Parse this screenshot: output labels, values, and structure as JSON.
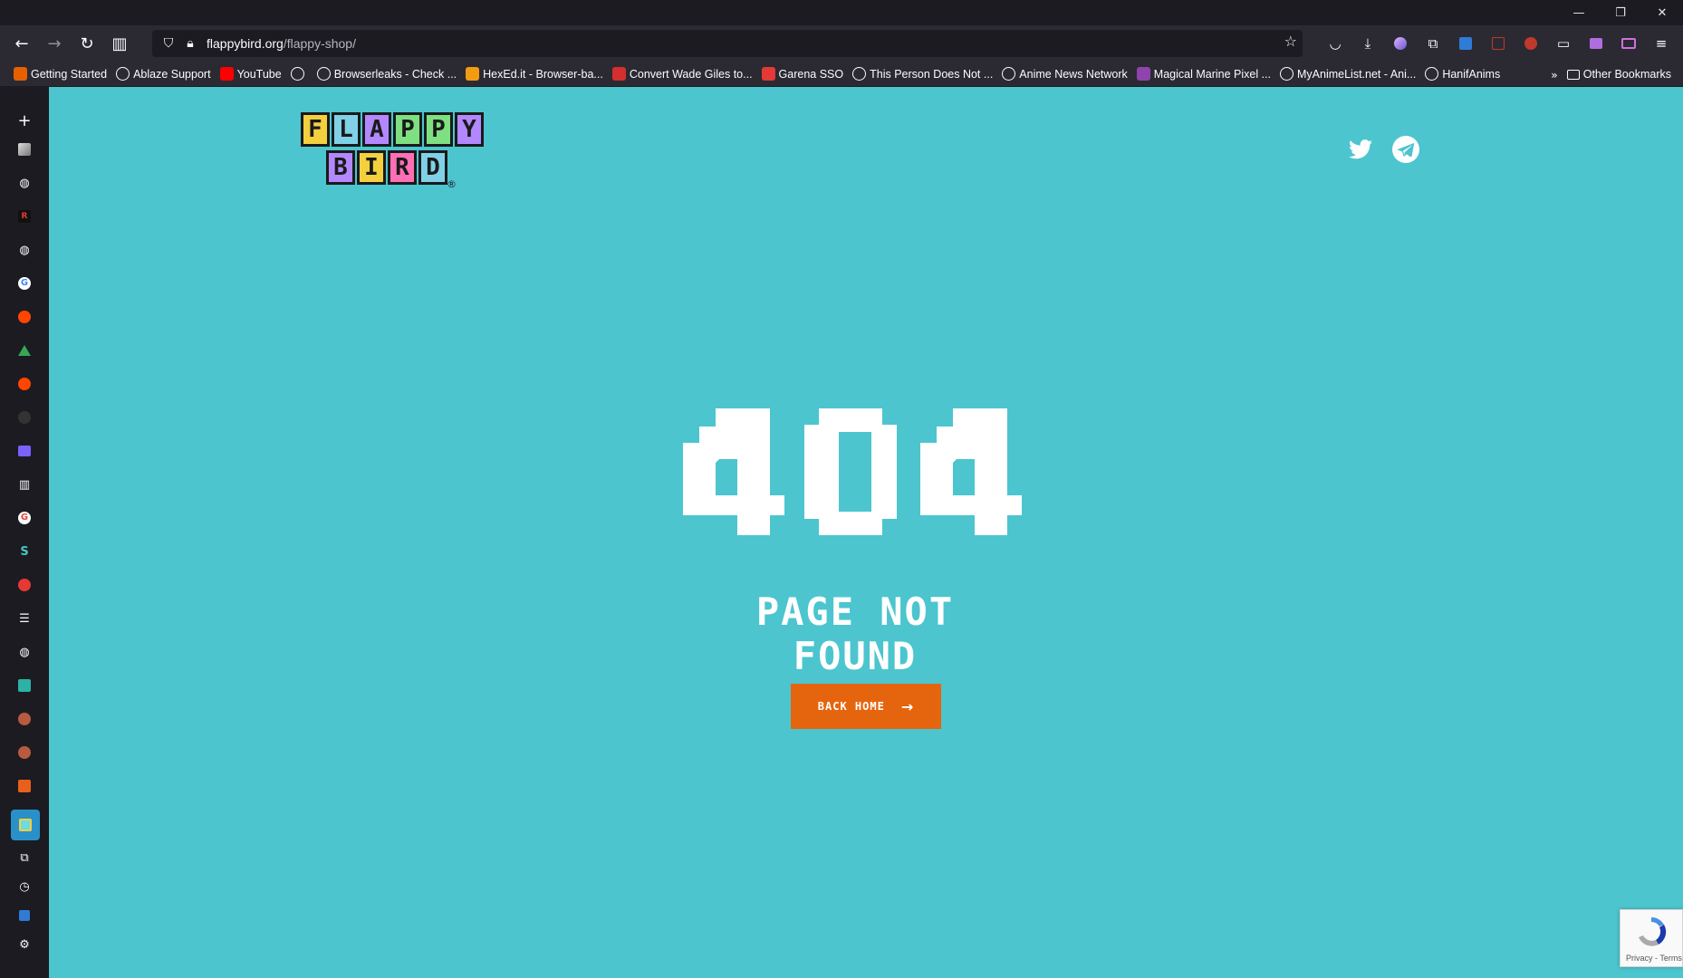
{
  "window": {
    "minimize": "—",
    "restore": "❐",
    "close": "✕"
  },
  "nav": {
    "url_domain": "flappybird.org",
    "url_path": "/flappy-shop/"
  },
  "bookmarks": [
    {
      "label": "Getting Started",
      "icon": "firefox-icon",
      "color": "#e66000"
    },
    {
      "label": "Ablaze Support",
      "icon": "globe-icon",
      "color": ""
    },
    {
      "label": "YouTube",
      "icon": "youtube-icon",
      "color": "#ff0000"
    },
    {
      "label": "",
      "icon": "globe-icon",
      "color": ""
    },
    {
      "label": "Browserleaks - Check ...",
      "icon": "globe-icon",
      "color": ""
    },
    {
      "label": "HexEd.it - Browser-ba...",
      "icon": "hexed-icon",
      "color": "#f39c12"
    },
    {
      "label": "Convert Wade Giles to...",
      "icon": "convert-icon",
      "color": "#d32f2f"
    },
    {
      "label": "Garena SSO",
      "icon": "garena-icon",
      "color": "#e53935"
    },
    {
      "label": "This Person Does Not ...",
      "icon": "globe-icon",
      "color": ""
    },
    {
      "label": "Anime News Network",
      "icon": "globe-icon",
      "color": ""
    },
    {
      "label": "Magical Marine Pixel ...",
      "icon": "pixel-icon",
      "color": "#8e44ad"
    },
    {
      "label": "MyAnimeList.net - Ani...",
      "icon": "globe-icon",
      "color": ""
    },
    {
      "label": "HanifAnims",
      "icon": "globe-icon",
      "color": ""
    }
  ],
  "bookmarks_other": "Other Bookmarks",
  "page": {
    "logo_top": [
      "F",
      "L",
      "A",
      "P",
      "P",
      "Y"
    ],
    "logo_bottom": [
      "B",
      "I",
      "R",
      "D"
    ],
    "logo_reg": "®",
    "code": "404",
    "title": "PAGE NOT FOUND",
    "button": "BACK HOME",
    "recaptcha_terms": "Privacy - Terms"
  }
}
